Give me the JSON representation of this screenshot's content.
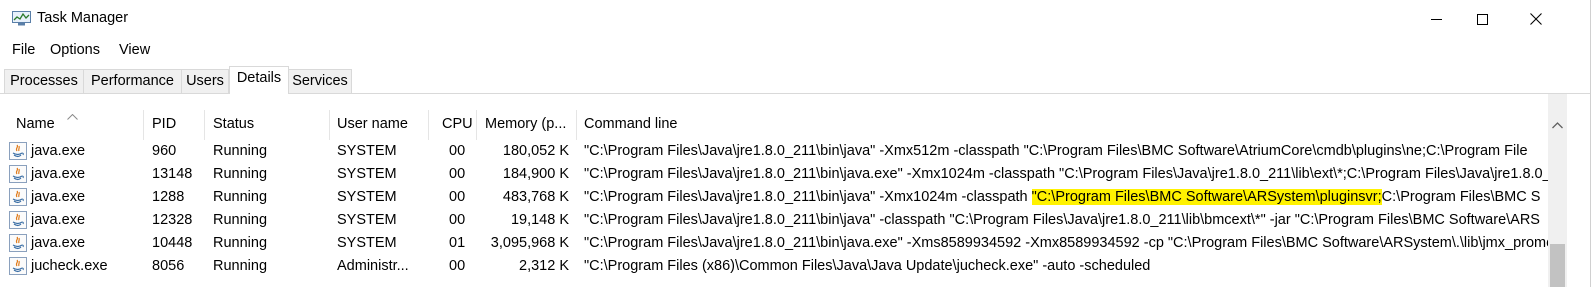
{
  "window": {
    "title": "Task Manager"
  },
  "menu": {
    "file": "File",
    "options": "Options",
    "view": "View"
  },
  "tabs": {
    "processes": "Processes",
    "performance": "Performance",
    "users": "Users",
    "details": "Details",
    "services": "Services"
  },
  "columns": {
    "name": "Name",
    "pid": "PID",
    "status": "Status",
    "user": "User name",
    "cpu": "CPU",
    "memory": "Memory (p...",
    "cmd": "Command line"
  },
  "rows": [
    {
      "name": "java.exe",
      "pid": "960",
      "status": "Running",
      "user": "SYSTEM",
      "cpu": "00",
      "memory": "180,052 K",
      "cmd_pre": "\"C:\\Program Files\\Java\\jre1.8.0_211\\bin\\java\" -Xmx512m -classpath \"C:\\Program Files\\BMC Software\\AtriumCore\\cmdb\\plugins\\ne;C:\\Program File",
      "cmd_hl": "",
      "cmd_post": ""
    },
    {
      "name": "java.exe",
      "pid": "13148",
      "status": "Running",
      "user": "SYSTEM",
      "cpu": "00",
      "memory": "184,900 K",
      "cmd_pre": "\"C:\\Program Files\\Java\\jre1.8.0_211\\bin\\java.exe\" -Xmx1024m -classpath \"C:\\Program Files\\Java\\jre1.8.0_211\\lib\\ext\\*;C:\\Program Files\\Java\\jre1.8.0_",
      "cmd_hl": "",
      "cmd_post": ""
    },
    {
      "name": "java.exe",
      "pid": "1288",
      "status": "Running",
      "user": "SYSTEM",
      "cpu": "00",
      "memory": "483,768 K",
      "cmd_pre": "\"C:\\Program Files\\Java\\jre1.8.0_211\\bin\\java\" -Xmx1024m -classpath ",
      "cmd_hl": "\"C:\\Program Files\\BMC Software\\ARSystem\\pluginsvr;",
      "cmd_post": "C:\\Program Files\\BMC S"
    },
    {
      "name": "java.exe",
      "pid": "12328",
      "status": "Running",
      "user": "SYSTEM",
      "cpu": "00",
      "memory": "19,148 K",
      "cmd_pre": "\"C:\\Program Files\\Java\\jre1.8.0_211\\bin\\java\" -classpath \"C:\\Program Files\\Java\\jre1.8.0_211\\lib\\bmcext\\*\" -jar \"C:\\Program Files\\BMC Software\\ARS",
      "cmd_hl": "",
      "cmd_post": ""
    },
    {
      "name": "java.exe",
      "pid": "10448",
      "status": "Running",
      "user": "SYSTEM",
      "cpu": "01",
      "memory": "3,095,968 K",
      "cmd_pre": "\"C:\\Program Files\\Java\\jre1.8.0_211\\bin\\java.exe\" -Xms8589934592 -Xmx8589934592 -cp \"C:\\Program Files\\BMC Software\\ARSystem\\.\\lib\\jmx_prome",
      "cmd_hl": "",
      "cmd_post": ""
    },
    {
      "name": "jucheck.exe",
      "pid": "8056",
      "status": "Running",
      "user": "Administr...",
      "cpu": "00",
      "memory": "2,312 K",
      "cmd_pre": "\"C:\\Program Files (x86)\\Common Files\\Java\\Java Update\\jucheck.exe\" -auto -scheduled",
      "cmd_hl": "",
      "cmd_post": ""
    }
  ],
  "icons": {
    "app": "task-manager-icon",
    "process": "java-process-icon",
    "minimize": "minimize-icon",
    "maximize": "maximize-icon",
    "close": "close-icon",
    "sort": "sort-ascending-icon",
    "scroll_up": "scroll-up-arrow-icon"
  },
  "colors": {
    "highlight": "#fff200",
    "tab_inactive": "#f0f0f0",
    "border": "#d9d9d9"
  }
}
